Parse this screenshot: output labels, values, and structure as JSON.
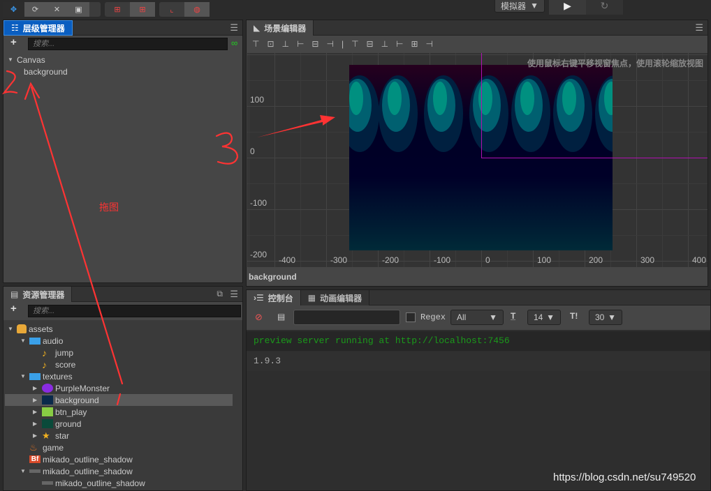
{
  "toolbar": {
    "tools": [
      "move-icon",
      "rotate-icon",
      "scale-icon",
      "rect-icon"
    ],
    "coords": [
      "local-icon",
      "global-icon"
    ],
    "pivots": [
      "pivot-icon",
      "center-icon"
    ],
    "simulator_label": "模拟器",
    "play": "play-icon",
    "refresh": "refresh-icon"
  },
  "hierarchy": {
    "title": "层级管理器",
    "search_placeholder": "搜索...",
    "items": [
      {
        "label": "Canvas",
        "expanded": true
      },
      {
        "label": "background"
      }
    ]
  },
  "assets": {
    "title": "资源管理器",
    "search_placeholder": "搜索...",
    "items": [
      {
        "label": "assets",
        "icon": "assets-db-icon",
        "depth": 0,
        "expanded": true
      },
      {
        "label": "audio",
        "icon": "folder-icon",
        "depth": 1,
        "expanded": true
      },
      {
        "label": "jump",
        "icon": "audio-note-icon",
        "depth": 2
      },
      {
        "label": "score",
        "icon": "audio-note-icon",
        "depth": 2
      },
      {
        "label": "textures",
        "icon": "folder-icon",
        "depth": 1,
        "expanded": true
      },
      {
        "label": "PurpleMonster",
        "icon": "texture-icon",
        "depth": 2,
        "collapsed": true
      },
      {
        "label": "background",
        "icon": "texture-icon",
        "depth": 2,
        "collapsed": true,
        "selected": true
      },
      {
        "label": "btn_play",
        "icon": "texture-icon",
        "depth": 2,
        "collapsed": true
      },
      {
        "label": "ground",
        "icon": "texture-icon",
        "depth": 2,
        "collapsed": true
      },
      {
        "label": "star",
        "icon": "star-icon",
        "depth": 2,
        "collapsed": true
      },
      {
        "label": "game",
        "icon": "scene-fire-icon",
        "depth": 1
      },
      {
        "label": "mikado_outline_shadow",
        "icon": "bitmap-font-icon",
        "depth": 1
      },
      {
        "label": "mikado_outline_shadow",
        "icon": "font-texture-icon",
        "depth": 1,
        "expanded": true
      },
      {
        "label": "mikado_outline_shadow",
        "icon": "font-texture-icon",
        "depth": 2
      }
    ]
  },
  "scene": {
    "title": "场景编辑器",
    "hint": "使用鼠标右键平移视窗焦点，使用滚轮缩放视图",
    "x_ticks": [
      "-400",
      "-300",
      "-200",
      "-100",
      "0",
      "100",
      "200",
      "300",
      "400"
    ],
    "y_ticks": [
      "100",
      "0",
      "-100",
      "-200"
    ],
    "selected_node": "background"
  },
  "console": {
    "tabs": [
      "控制台",
      "动画编辑器"
    ],
    "filter_value": "",
    "regex_label": "Regex",
    "regex_checked": false,
    "level": "All",
    "font_size": "14",
    "line_count": "30",
    "logs": [
      {
        "text": "preview server running at http://localhost:7456",
        "color": "#1a9a1a"
      },
      {
        "text": "1.9.3",
        "color": "#aaaaaa"
      }
    ]
  },
  "annotations": {
    "numbers": [
      "1",
      "2",
      "3"
    ],
    "text": "拖图",
    "color": "#ff3333"
  },
  "watermark": "https://blog.csdn.net/su749520"
}
